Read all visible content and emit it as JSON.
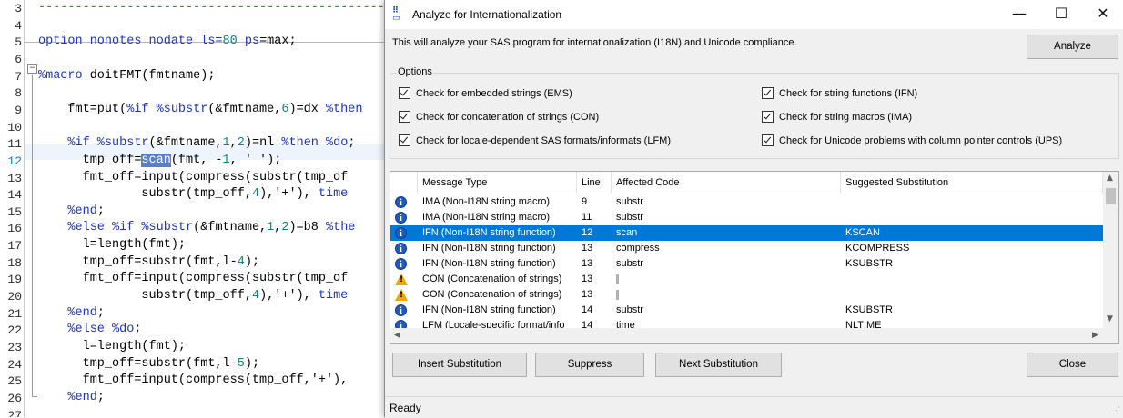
{
  "editor": {
    "lines": [
      {
        "n": "3",
        "parts": [
          {
            "t": "---------------------------------------------------",
            "c": "dash"
          }
        ]
      },
      {
        "n": "4",
        "parts": []
      },
      {
        "n": "5",
        "parts": [
          {
            "t": "option nonotes nodate ls=",
            "c": "kw"
          },
          {
            "t": "80",
            "c": "num"
          },
          {
            "t": " ps",
            "c": "kw"
          },
          {
            "t": "=max;",
            "c": ""
          }
        ]
      },
      {
        "n": "6",
        "parts": []
      },
      {
        "n": "7",
        "parts": [
          {
            "t": "%macro",
            "c": "kw"
          },
          {
            "t": " doitFMT(fmtname);",
            "c": ""
          }
        ]
      },
      {
        "n": "8",
        "parts": []
      },
      {
        "n": "9",
        "parts": [
          {
            "t": "    fmt=put(",
            "c": ""
          },
          {
            "t": "%if %substr",
            "c": "kw"
          },
          {
            "t": "(&fmtname,",
            "c": ""
          },
          {
            "t": "6",
            "c": "num"
          },
          {
            "t": ")=dx ",
            "c": ""
          },
          {
            "t": "%then",
            "c": "kw"
          }
        ]
      },
      {
        "n": "10",
        "parts": []
      },
      {
        "n": "11",
        "parts": [
          {
            "t": "    ",
            "c": ""
          },
          {
            "t": "%if %substr",
            "c": "kw"
          },
          {
            "t": "(&fmtname,",
            "c": ""
          },
          {
            "t": "1",
            "c": "num"
          },
          {
            "t": ",",
            "c": ""
          },
          {
            "t": "2",
            "c": "num"
          },
          {
            "t": ")=nl ",
            "c": ""
          },
          {
            "t": "%then %do",
            "c": "kw"
          },
          {
            "t": ";",
            "c": ""
          }
        ]
      },
      {
        "n": "12",
        "parts": [
          {
            "t": "      tmp_off=",
            "c": ""
          },
          {
            "t": "scan",
            "c": "sel"
          },
          {
            "t": "(fmt, -",
            "c": ""
          },
          {
            "t": "1",
            "c": "num"
          },
          {
            "t": ", ' ');",
            "c": ""
          }
        ]
      },
      {
        "n": "13",
        "parts": [
          {
            "t": "      fmt_off=input(compress(substr(tmp_of",
            "c": ""
          }
        ]
      },
      {
        "n": "14",
        "parts": [
          {
            "t": "              substr(tmp_off,",
            "c": ""
          },
          {
            "t": "4",
            "c": "num"
          },
          {
            "t": "),'+'), ",
            "c": ""
          },
          {
            "t": "time",
            "c": "kw"
          }
        ]
      },
      {
        "n": "15",
        "parts": [
          {
            "t": "    ",
            "c": ""
          },
          {
            "t": "%end",
            "c": "kw"
          },
          {
            "t": ";",
            "c": ""
          }
        ]
      },
      {
        "n": "16",
        "parts": [
          {
            "t": "    ",
            "c": ""
          },
          {
            "t": "%else %if %substr",
            "c": "kw"
          },
          {
            "t": "(&fmtname,",
            "c": ""
          },
          {
            "t": "1",
            "c": "num"
          },
          {
            "t": ",",
            "c": ""
          },
          {
            "t": "2",
            "c": "num"
          },
          {
            "t": ")=b8 ",
            "c": ""
          },
          {
            "t": "%the",
            "c": "kw"
          }
        ]
      },
      {
        "n": "17",
        "parts": [
          {
            "t": "      l=length(fmt);",
            "c": ""
          }
        ]
      },
      {
        "n": "18",
        "parts": [
          {
            "t": "      tmp_off=substr(fmt,l-",
            "c": ""
          },
          {
            "t": "4",
            "c": "num"
          },
          {
            "t": ");",
            "c": ""
          }
        ]
      },
      {
        "n": "19",
        "parts": [
          {
            "t": "      fmt_off=input(compress(substr(tmp_of",
            "c": ""
          }
        ]
      },
      {
        "n": "20",
        "parts": [
          {
            "t": "              substr(tmp_off,",
            "c": ""
          },
          {
            "t": "4",
            "c": "num"
          },
          {
            "t": "),'+'), ",
            "c": ""
          },
          {
            "t": "time",
            "c": "kw"
          }
        ]
      },
      {
        "n": "21",
        "parts": [
          {
            "t": "    ",
            "c": ""
          },
          {
            "t": "%end",
            "c": "kw"
          },
          {
            "t": ";",
            "c": ""
          }
        ]
      },
      {
        "n": "22",
        "parts": [
          {
            "t": "    ",
            "c": ""
          },
          {
            "t": "%else %do",
            "c": "kw"
          },
          {
            "t": ";",
            "c": ""
          }
        ]
      },
      {
        "n": "23",
        "parts": [
          {
            "t": "      l=length(fmt);",
            "c": ""
          }
        ]
      },
      {
        "n": "24",
        "parts": [
          {
            "t": "      tmp_off=substr(fmt,l-",
            "c": ""
          },
          {
            "t": "5",
            "c": "num"
          },
          {
            "t": ");",
            "c": ""
          }
        ]
      },
      {
        "n": "25",
        "parts": [
          {
            "t": "      fmt_off=input(compress(tmp_off,'+'),",
            "c": ""
          }
        ]
      },
      {
        "n": "26",
        "parts": [
          {
            "t": "    ",
            "c": ""
          },
          {
            "t": "%end",
            "c": "kw"
          },
          {
            "t": ";",
            "c": ""
          }
        ]
      },
      {
        "n": "27",
        "parts": []
      }
    ]
  },
  "dialog": {
    "title": "Analyze for Internationalization",
    "minimize": "—",
    "maximize": "☐",
    "close": "✕",
    "description": "This will analyze your SAS program for internationalization (I18N) and Unicode compliance.",
    "analyze_label": "Analyze",
    "options_label": "Options",
    "options": [
      {
        "label": "Check for embedded strings (EMS)",
        "checked": true
      },
      {
        "label": "Check for concatenation of strings (CON)",
        "checked": true
      },
      {
        "label": "Check for locale-dependent SAS formats/informats  (LFM)",
        "checked": true
      },
      {
        "label": "Check for string functions (IFN)",
        "checked": true
      },
      {
        "label": "Check for string macros (IMA)",
        "checked": true
      },
      {
        "label": "Check for Unicode problems with column pointer controls (UPS)",
        "checked": true
      }
    ],
    "columns": [
      "Message Type",
      "Line",
      "Affected Code",
      "Suggested Substitution"
    ],
    "rows": [
      {
        "icon": "info",
        "type": "IMA (Non-I18N string macro)",
        "line": "9",
        "code": "substr",
        "sub": "",
        "selected": false
      },
      {
        "icon": "info",
        "type": "IMA (Non-I18N string macro)",
        "line": "11",
        "code": "substr",
        "sub": "",
        "selected": false
      },
      {
        "icon": "info",
        "type": "IFN (Non-I18N string function)",
        "line": "12",
        "code": "scan",
        "sub": "KSCAN",
        "selected": true
      },
      {
        "icon": "info",
        "type": "IFN (Non-I18N string function)",
        "line": "13",
        "code": "compress",
        "sub": "KCOMPRESS",
        "selected": false
      },
      {
        "icon": "info",
        "type": "IFN (Non-I18N string function)",
        "line": "13",
        "code": "substr",
        "sub": "KSUBSTR",
        "selected": false
      },
      {
        "icon": "warn",
        "type": "CON (Concatenation of strings)",
        "line": "13",
        "code": "|",
        "sub": "",
        "selected": false
      },
      {
        "icon": "warn",
        "type": "CON (Concatenation of strings)",
        "line": "13",
        "code": "|",
        "sub": "",
        "selected": false
      },
      {
        "icon": "info",
        "type": "IFN (Non-I18N string function)",
        "line": "14",
        "code": "substr",
        "sub": "KSUBSTR",
        "selected": false
      },
      {
        "icon": "info",
        "type": "LFM (Locale-specific format/info",
        "line": "14",
        "code": "time",
        "sub": "NLTIME",
        "selected": false
      }
    ],
    "insert_label": "Insert Substitution",
    "suppress_label": "Suppress",
    "next_label": "Next Substitution",
    "close_label": "Close",
    "status": "Ready"
  }
}
